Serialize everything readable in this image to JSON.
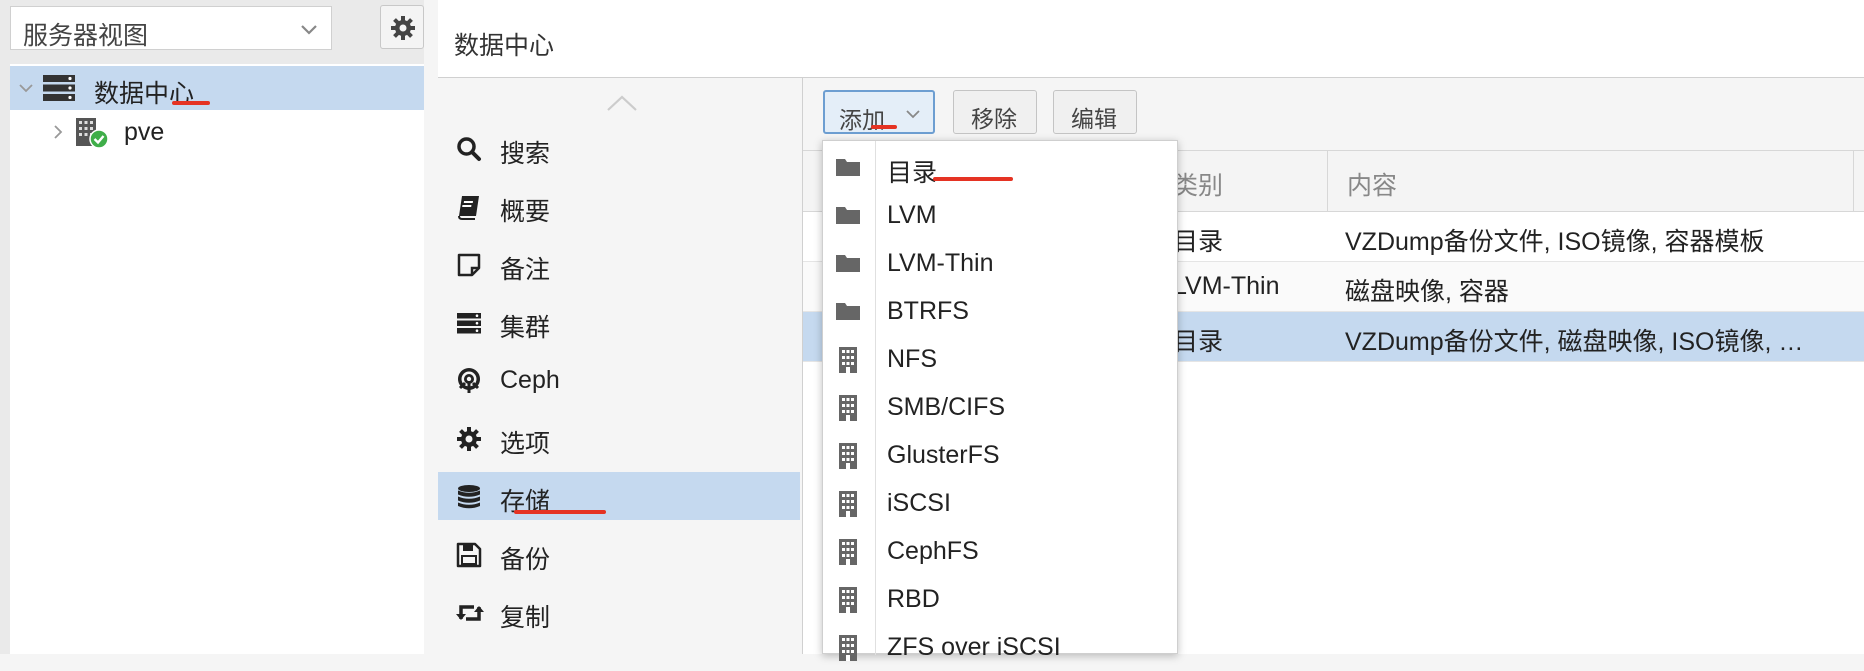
{
  "left_panel": {
    "view_select": "服务器视图",
    "tree": [
      {
        "label": "数据中心",
        "icon": "datacenter-icon",
        "expanded": true
      },
      {
        "label": "pve",
        "icon": "node-online-icon",
        "expanded": false
      }
    ]
  },
  "header": {
    "title": "数据中心"
  },
  "nav": {
    "items": [
      {
        "label": "搜索",
        "icon": "search-icon"
      },
      {
        "label": "概要",
        "icon": "book-icon"
      },
      {
        "label": "备注",
        "icon": "note-icon"
      },
      {
        "label": "集群",
        "icon": "server-icon"
      },
      {
        "label": "Ceph",
        "icon": "ceph-icon"
      },
      {
        "label": "选项",
        "icon": "gear-icon"
      },
      {
        "label": "存储",
        "icon": "database-icon"
      },
      {
        "label": "备份",
        "icon": "floppy-icon"
      },
      {
        "label": "复制",
        "icon": "retweet-icon"
      }
    ],
    "selected": "存储"
  },
  "toolbar": {
    "add_label": "添加",
    "remove_label": "移除",
    "edit_label": "编辑"
  },
  "grid": {
    "columns": [
      "类别",
      "内容"
    ],
    "rows": [
      {
        "type": "目录",
        "content": "VZDump备份文件, ISO镜像, 容器模板"
      },
      {
        "type": "LVM-Thin",
        "content": "磁盘映像, 容器"
      },
      {
        "type": "目录",
        "content": "VZDump备份文件, 磁盘映像, ISO镜像, …"
      }
    ]
  },
  "add_menu": {
    "items": [
      {
        "label": "目录",
        "icon": "folder-icon"
      },
      {
        "label": "LVM",
        "icon": "folder-icon"
      },
      {
        "label": "LVM-Thin",
        "icon": "folder-icon"
      },
      {
        "label": "BTRFS",
        "icon": "folder-icon"
      },
      {
        "label": "NFS",
        "icon": "building-icon"
      },
      {
        "label": "SMB/CIFS",
        "icon": "building-icon"
      },
      {
        "label": "GlusterFS",
        "icon": "building-icon"
      },
      {
        "label": "iSCSI",
        "icon": "building-icon"
      },
      {
        "label": "CephFS",
        "icon": "building-icon"
      },
      {
        "label": "RBD",
        "icon": "building-icon"
      },
      {
        "label": "ZFS over iSCSI",
        "icon": "building-icon"
      }
    ]
  },
  "colors": {
    "selection": "#c5d9ef",
    "annotation": "#e53323",
    "online": "#3fae49"
  }
}
